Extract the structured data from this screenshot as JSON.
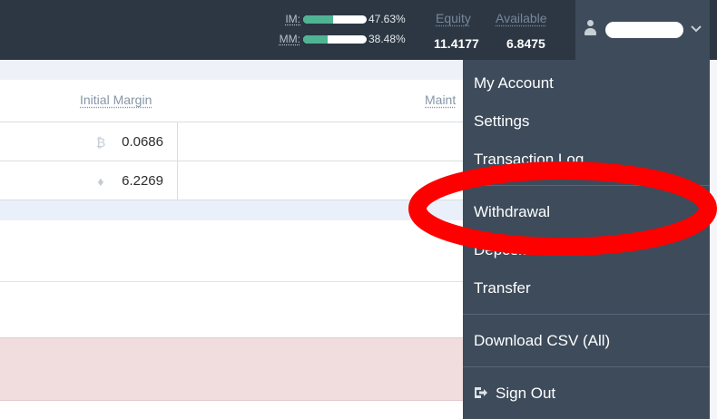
{
  "header": {
    "im": {
      "label": "IM:",
      "percent": "47.63%",
      "fill": 0.4763
    },
    "mm": {
      "label": "MM:",
      "percent": "38.48%",
      "fill": 0.3848
    },
    "equity": {
      "label": "Equity",
      "value": "11.4177"
    },
    "available": {
      "label": "Available",
      "value": "6.8475"
    },
    "user": {
      "icon": "user-icon",
      "name_redacted": true,
      "chevron_icon": "chevron-down-icon"
    }
  },
  "table": {
    "headers": {
      "initial_margin": "Initial Margin",
      "maint_partial": "Maint"
    },
    "rows": [
      {
        "coin_icon": "bitcoin-icon",
        "coin_glyph": "₿",
        "initial_margin": "0.0686"
      },
      {
        "coin_icon": "ethereum-icon",
        "coin_glyph": "♦",
        "initial_margin": "6.2269"
      }
    ]
  },
  "menu": {
    "items": [
      {
        "label": "My Account"
      },
      {
        "label": "Settings"
      },
      {
        "label": "Transaction Log"
      },
      {
        "label": "Withdrawal"
      },
      {
        "label": "Deposit"
      },
      {
        "label": "Transfer"
      },
      {
        "label": "Download CSV (All)"
      },
      {
        "label": "Sign Out",
        "icon": "sign-out-icon"
      }
    ]
  },
  "colors": {
    "header_bg": "#2c3743",
    "menu_bg": "#3d4b5b",
    "bar_fill": "#4fb493",
    "annotation": "#ff0000",
    "row_highlight": "#f1dcde"
  }
}
